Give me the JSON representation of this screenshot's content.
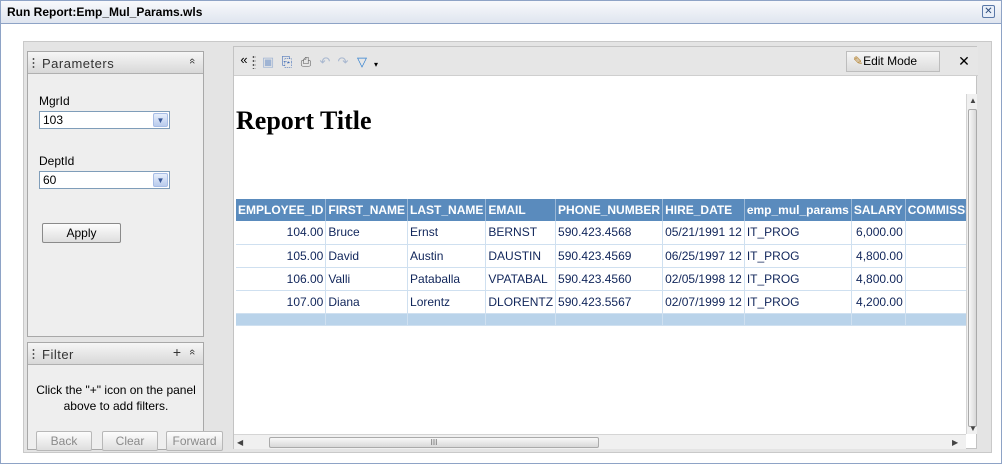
{
  "window": {
    "title": "Run Report:Emp_Mul_Params.wls",
    "close_glyph": "✕"
  },
  "parameters_panel": {
    "title": "Parameters",
    "collapse_glyph": "«",
    "fields": [
      {
        "label": "MgrId",
        "value": "103"
      },
      {
        "label": "DeptId",
        "value": "60"
      }
    ],
    "apply_label": "Apply"
  },
  "filter_panel": {
    "title": "Filter",
    "add_glyph": "+",
    "message": "Click the \"+\" icon on the panel above to add filters.",
    "buttons": {
      "back": "Back",
      "clear": "Clear",
      "forward": "Forward"
    }
  },
  "toolbar": {
    "collapse_glyph": "«",
    "edit_mode_label": "Edit Mode",
    "close_glyph": "✕"
  },
  "report": {
    "title": "Report Title",
    "columns": [
      "EMPLOYEE_ID",
      "FIRST_NAME",
      "LAST_NAME",
      "EMAIL",
      "PHONE_NUMBER",
      "HIRE_DATE",
      "emp_mul_params",
      "SALARY",
      "COMMISSION"
    ],
    "rows": [
      [
        "104.00",
        "Bruce",
        "Ernst",
        "BERNST",
        "590.423.4568",
        "05/21/1991 12",
        "IT_PROG",
        "6,000.00",
        ""
      ],
      [
        "105.00",
        "David",
        "Austin",
        "DAUSTIN",
        "590.423.4569",
        "06/25/1997 12",
        "IT_PROG",
        "4,800.00",
        ""
      ],
      [
        "106.00",
        "Valli",
        "Pataballa",
        "VPATABAL",
        "590.423.4560",
        "02/05/1998 12",
        "IT_PROG",
        "4,800.00",
        ""
      ],
      [
        "107.00",
        "Diana",
        "Lorentz",
        "DLORENTZ",
        "590.423.5567",
        "02/07/1999 12",
        "IT_PROG",
        "4,200.00",
        ""
      ]
    ]
  },
  "scrollbar": {
    "grip": "III"
  },
  "colors": {
    "header_bg": "#5a8bbd",
    "total_row_bg": "#b9d3ea",
    "cell_text": "#10255a"
  }
}
